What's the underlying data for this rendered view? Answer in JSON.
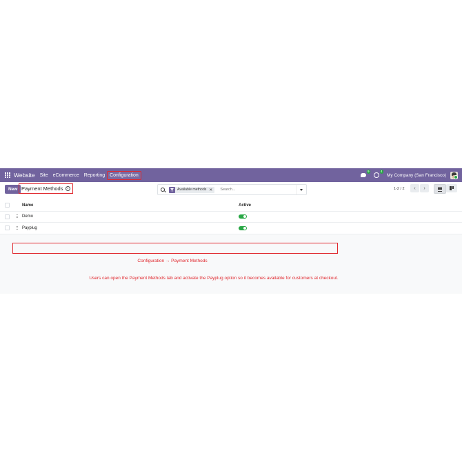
{
  "navbar": {
    "brand": "Website",
    "menu": [
      "Site",
      "eCommerce",
      "Reporting",
      "Configuration"
    ],
    "messages_badge": "9",
    "activities_badge": "4",
    "company": "My Company (San Francisco)"
  },
  "control_panel": {
    "new_label": "New",
    "breadcrumb": "Payment Methods",
    "search": {
      "facet": "Available methods",
      "placeholder": "Search..."
    },
    "pager": "1-2 / 2"
  },
  "list": {
    "columns": [
      "Name",
      "Active"
    ],
    "rows": [
      {
        "name": "Demo",
        "active": true
      },
      {
        "name": "Payplug",
        "active": true
      }
    ]
  },
  "annotations": {
    "caption_path": "Configuration → Payment Methods",
    "caption_note": "Users can open the Payment Methods tab and activate the Payplug option so it becomes available for customers at checkout."
  },
  "colors": {
    "navbar": "#71639e",
    "toggle_on": "#28a745",
    "highlight": "#e0282e"
  }
}
